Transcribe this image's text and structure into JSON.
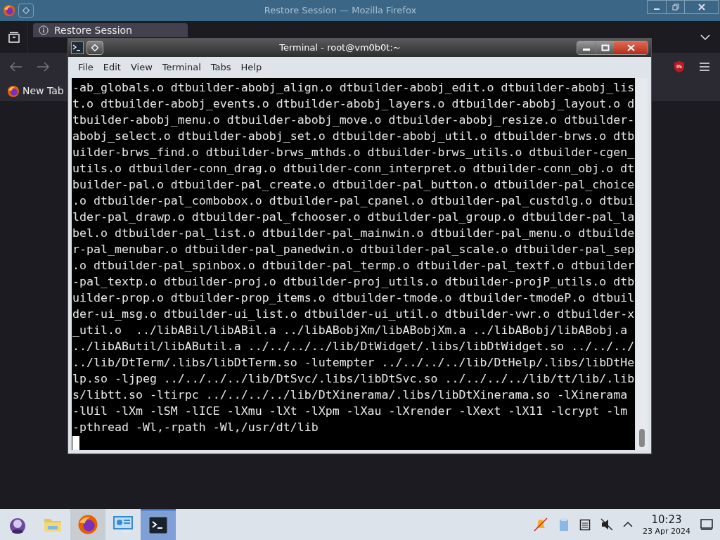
{
  "browser": {
    "title": "Restore Session — Mozilla Firefox",
    "tab": {
      "label": "Restore Session",
      "selected": true
    },
    "bookmarks": [
      "New Tab"
    ]
  },
  "terminal": {
    "title": "Terminal - root@vm0b0t:~",
    "menu": [
      "File",
      "Edit",
      "View",
      "Terminal",
      "Tabs",
      "Help"
    ],
    "lines": [
      "-ab_globals.o dtbuilder-abobj_align.o dtbuilder-abobj_edit.o dtbuilder-abobj_lis",
      "t.o dtbuilder-abobj_events.o dtbuilder-abobj_layers.o dtbuilder-abobj_layout.o d",
      "tbuilder-abobj_menu.o dtbuilder-abobj_move.o dtbuilder-abobj_resize.o dtbuilder-",
      "abobj_select.o dtbuilder-abobj_set.o dtbuilder-abobj_util.o dtbuilder-brws.o dtb",
      "uilder-brws_find.o dtbuilder-brws_mthds.o dtbuilder-brws_utils.o dtbuilder-cgen_",
      "utils.o dtbuilder-conn_drag.o dtbuilder-conn_interpret.o dtbuilder-conn_obj.o dt",
      "builder-pal.o dtbuilder-pal_create.o dtbuilder-pal_button.o dtbuilder-pal_choice",
      ".o dtbuilder-pal_combobox.o dtbuilder-pal_cpanel.o dtbuilder-pal_custdlg.o dtbui",
      "lder-pal_drawp.o dtbuilder-pal_fchooser.o dtbuilder-pal_group.o dtbuilder-pal_la",
      "bel.o dtbuilder-pal_list.o dtbuilder-pal_mainwin.o dtbuilder-pal_menu.o dtbuilde",
      "r-pal_menubar.o dtbuilder-pal_panedwin.o dtbuilder-pal_scale.o dtbuilder-pal_sep",
      ".o dtbuilder-pal_spinbox.o dtbuilder-pal_termp.o dtbuilder-pal_textf.o dtbuilder",
      "-pal_textp.o dtbuilder-proj.o dtbuilder-proj_utils.o dtbuilder-projP_utils.o dtb",
      "uilder-prop.o dtbuilder-prop_items.o dtbuilder-tmode.o dtbuilder-tmodeP.o dtbuil",
      "der-ui_msg.o dtbuilder-ui_list.o dtbuilder-ui_util.o dtbuilder-vwr.o dtbuilder-x",
      "_util.o  ../libABil/libABil.a ../libABobjXm/libABobjXm.a ../libABobj/libABobj.a",
      "../libAButil/libAButil.a ../../../../lib/DtWidget/.libs/libDtWidget.so ../../../",
      "../lib/DtTerm/.libs/libDtTerm.so -lutempter ../../../../lib/DtHelp/.libs/libDtHe",
      "lp.so -ljpeg ../../../../lib/DtSvc/.libs/libDtSvc.so ../../../../lib/tt/lib/.lib",
      "s/libtt.so -ltirpc ../../../../lib/DtXinerama/.libs/libDtXinerama.so -lXinerama",
      "-lUil -lXm -lSM -lICE -lXmu -lXt -lXpm -lXau -lXrender -lXext -lX11 -lcrypt -lm",
      "-pthread -Wl,-rpath -Wl,/usr/dt/lib"
    ]
  },
  "taskbar": {
    "apps": [
      {
        "kind": "launcher",
        "selected": false
      },
      {
        "kind": "files",
        "selected": false
      },
      {
        "kind": "browser",
        "selected": false
      },
      {
        "kind": "settings",
        "selected": false
      },
      {
        "kind": "terminal",
        "selected": true
      }
    ],
    "time": "10:23",
    "date": "23 Apr 2024"
  }
}
